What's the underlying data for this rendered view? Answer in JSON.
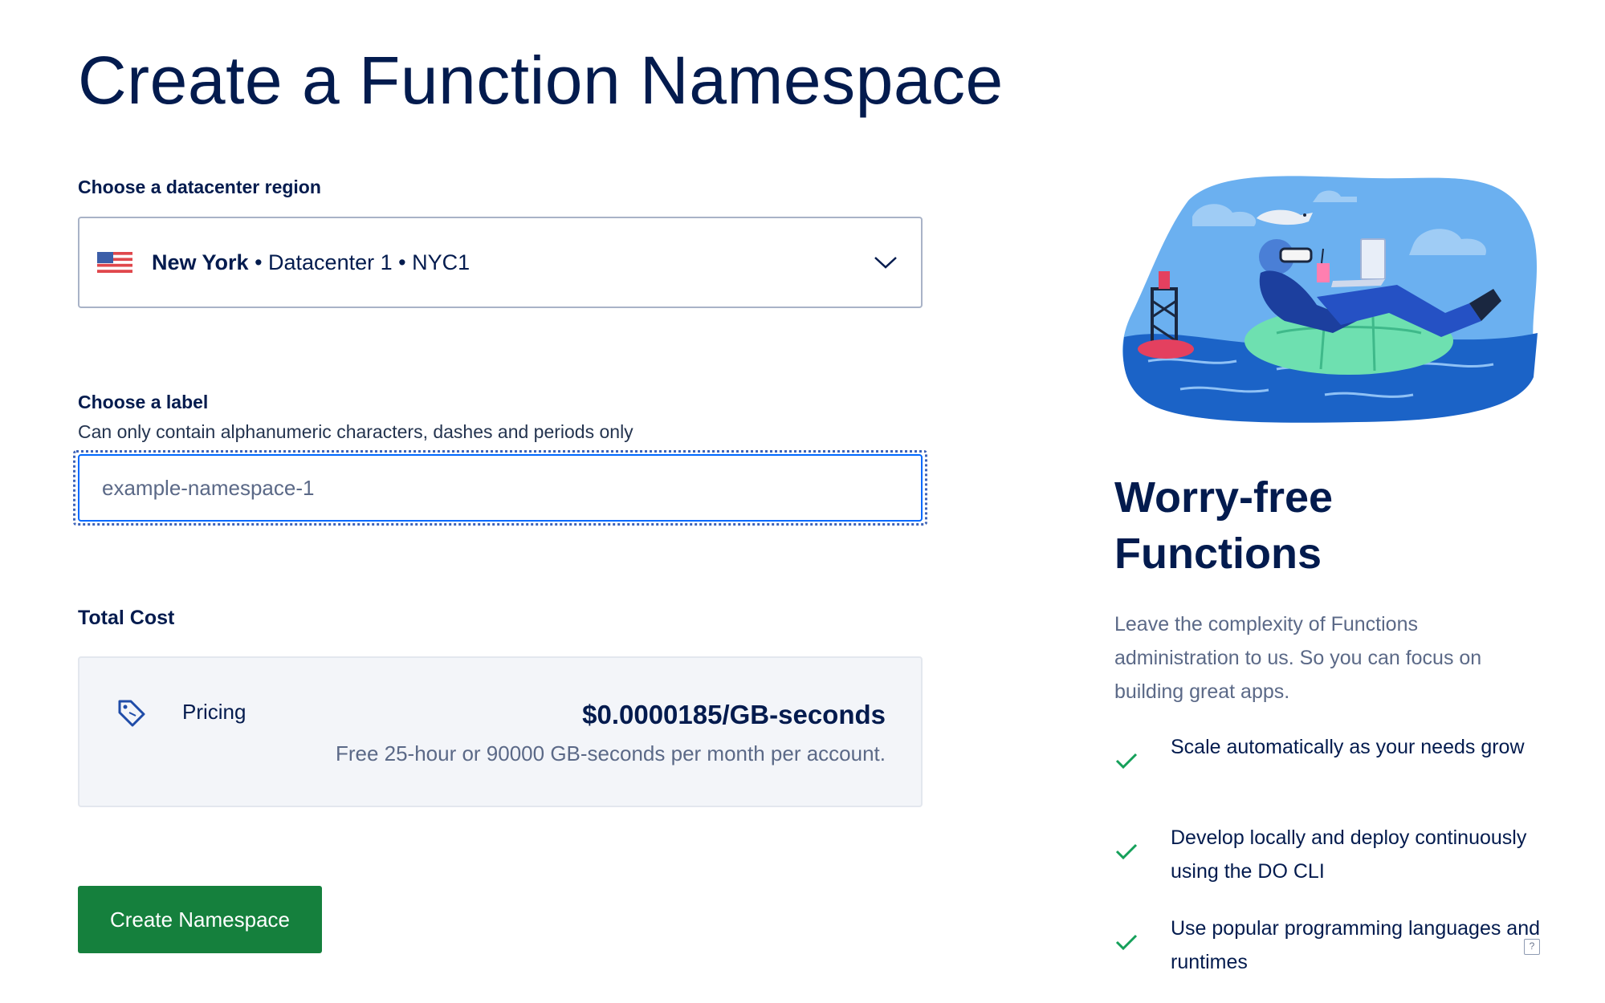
{
  "page": {
    "title": "Create a Function Namespace"
  },
  "region": {
    "label": "Choose a datacenter region",
    "selected_name": "New York",
    "selected_detail": " • Datacenter 1 • NYC1",
    "flag_icon": "us-flag-icon"
  },
  "label_field": {
    "label": "Choose a label",
    "hint": "Can only contain alphanumeric characters, dashes and periods only",
    "value": "example-namespace-1"
  },
  "cost": {
    "label": "Total Cost",
    "pricing_label": "Pricing",
    "price": "$0.0000185/GB-seconds",
    "note": "Free 25-hour or 90000 GB-seconds per month per account."
  },
  "actions": {
    "create_label": "Create Namespace"
  },
  "sidebar": {
    "title": "Worry-free Functions",
    "description": "Leave the complexity of Functions administration to us. So you can focus on building great apps.",
    "features": [
      "Scale automatically as your needs grow",
      "Develop locally and deploy continuously using the DO CLI",
      "Use popular programming languages and runtimes"
    ]
  },
  "help": {
    "label": "?"
  },
  "colors": {
    "primary_text": "#031b4e",
    "muted_text": "#5b6987",
    "focus_blue": "#0069ff",
    "button_green": "#15803d",
    "check_green": "#15a05a"
  }
}
